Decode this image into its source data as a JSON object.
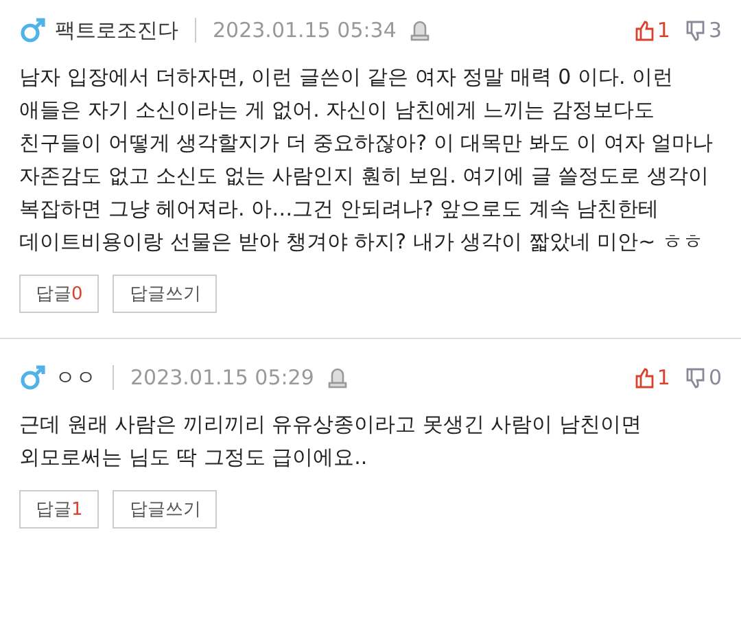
{
  "comments": [
    {
      "author": "팩트로조진다",
      "time": "2023.01.15 05:34",
      "likes": "1",
      "dislikes": "3",
      "body": "남자 입장에서 더하자면, 이런 글쓴이 같은 여자 정말 매력 0 이다. 이런 애들은 자기 소신이라는 게 없어. 자신이 남친에게 느끼는 감정보다도 친구들이 어떻게 생각할지가 더 중요하잖아? 이 대목만 봐도 이 여자 얼마나 자존감도 없고 소신도 없는 사람인지 훤히 보임. 여기에 글 쓸정도로 생각이 복잡하면 그냥 헤어져라. 아…그건 안되려나? 앞으로도 계속 남친한테 데이트비용이랑 선물은 받아 챙겨야 하지? 내가 생각이 짧았네 미안~ ㅎㅎ",
      "reply_label": "답글",
      "reply_count": "0",
      "write_label": "답글쓰기"
    },
    {
      "author": "ㅇㅇ",
      "time": "2023.01.15 05:29",
      "likes": "1",
      "dislikes": "0",
      "body": "근데 원래 사람은 끼리끼리 유유상종이라고 못생긴 사람이 남친이면 외모로써는 님도 딱 그정도 급이에요..",
      "reply_label": "답글",
      "reply_count": "1",
      "write_label": "답글쓰기"
    }
  ]
}
